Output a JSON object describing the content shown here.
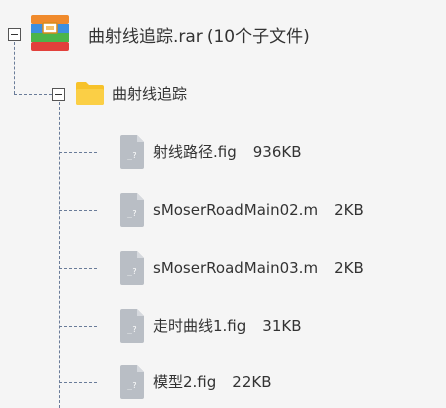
{
  "root": {
    "name": "曲射线追踪.rar",
    "summary": "(10个子文件)"
  },
  "folder": {
    "name": "曲射线追踪"
  },
  "files": [
    {
      "name": "射线路径.fig",
      "size": "936KB",
      "icon_glyph": "_?"
    },
    {
      "name": "sMoserRoadMain02.m",
      "size": "2KB",
      "icon_glyph": "_?"
    },
    {
      "name": "sMoserRoadMain03.m",
      "size": "2KB",
      "icon_glyph": "_?"
    },
    {
      "name": "走时曲线1.fig",
      "size": "31KB",
      "icon_glyph": "_?"
    },
    {
      "name": "模型2.fig",
      "size": "22KB",
      "icon_glyph": "_?"
    }
  ],
  "colors": {
    "background": "#f5f5f5",
    "tree_line": "#6a7c99",
    "folder_yellow": "#f7c22a",
    "file_icon_gray": "#b9bec5",
    "rar_orange": "#f08a2c",
    "rar_blue": "#3d8fe0",
    "rar_green": "#4cb54a",
    "rar_red": "#e2403b"
  },
  "icons": {
    "archive": "rar-archive-icon",
    "folder": "folder-icon",
    "file": "unknown-file-icon"
  }
}
